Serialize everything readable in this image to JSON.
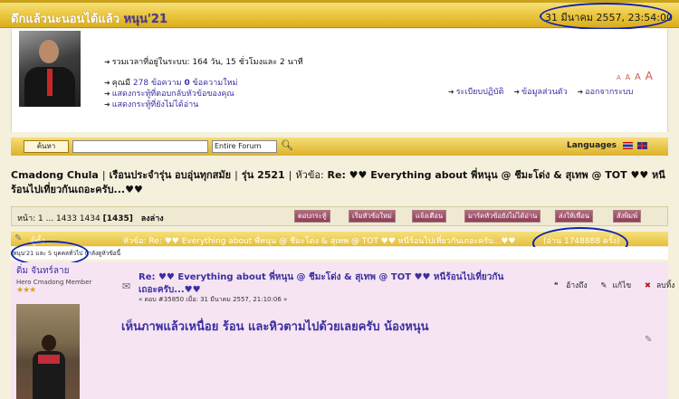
{
  "header": {
    "forum_title": "ดึกแล้วนะนอนได้แล้ว",
    "username": "หนุน'21",
    "datetime": "31 มีนาคม 2557, 23:54:00"
  },
  "user_panel": {
    "time_online": "รวมเวลาที่อยู่ในระบบ: 164 วัน, 15 ชั่วโมงและ 2 นาที",
    "posts_prefix": "คุณมี",
    "posts_count": "278",
    "posts_unit": "ข้อความ",
    "new_count": "0",
    "new_label": "ข้อความใหม่",
    "link_replies": "แสดงกระทู้ที่ตอบกลับหัวข้อของคุณ",
    "link_unread": "แสดงกระทู้ที่ยังไม่ได้อ่าน",
    "font_sizes": [
      "A",
      "A",
      "A",
      "A"
    ],
    "link_rules": "ระเบียบปฏิบัติ",
    "link_profile": "ข้อมูลส่วนตัว",
    "link_logout": "ออกจากระบบ"
  },
  "search": {
    "button": "ค้นหา",
    "scope": "Entire Forum",
    "languages_label": "Languages"
  },
  "breadcrumb": {
    "items": [
      "Cmadong Chula",
      "เรือนประจำรุ่น อบอุ่นทุกสมัย",
      "รุ่น 2521"
    ],
    "topic_prefix": "หัวข้อ:",
    "topic": "Re: ♥♥ Everything about พี่หนุน @ ชีมะโด่ง & สุเทพ @ TOT ♥♥ หนีร้อนไปเที่ยวกันเถอะครับ...♥♥"
  },
  "toolbar": {
    "pages_label": "หน้า: 1 ... 1433 1434",
    "current_page": "[1435]",
    "go_down": "ลงล่าง",
    "buttons": [
      "ตอบกระทู้",
      "เริ่มหัวข้อใหม่",
      "แจ้งเตือน",
      "มาร์คหัวข้อยังไม่ได้อ่าน",
      "ส่งให้เพื่อน",
      "สั่งพิมพ์"
    ]
  },
  "thread_header": {
    "author_label": "ผู้ตั้ง",
    "title": "หัวข้อ: Re: ♥♥ Everything about พี่หนุน @ ชีมะโด่ง & สุเทพ @ TOT ♥♥ หนีร้อนไปเที่ยวกันเถอะครับ...♥♥",
    "views": "(อ่าน 1748888 ครั้ง)"
  },
  "viewers": "หนุน'21 และ 5 บุคคลทั่วไป กำลังดูหัวข้อนี้",
  "post": {
    "author": "ดิ่ม จันทร์ลาย",
    "rank": "Hero Cmadong Member",
    "stars": "★★★",
    "title": "Re: ♥♥ Everything about พี่หนุน @ ชีมะโด่ง & สุเทพ @ TOT ♥♥ หนีร้อนไปเที่ยวกันเถอะครับ...♥♥",
    "meta": "« ตอบ #35850 เมื่อ: 31 มีนาคม 2557, 21:10:06 »",
    "action_quote": "อ้างถึง",
    "action_edit": "แก้ไข",
    "action_delete": "ลบทิ้ง",
    "body": "เห็นภาพแล้วเหนื่อย ร้อน และหิวตามไปด้วยเลยครับ น้องหนุน"
  }
}
